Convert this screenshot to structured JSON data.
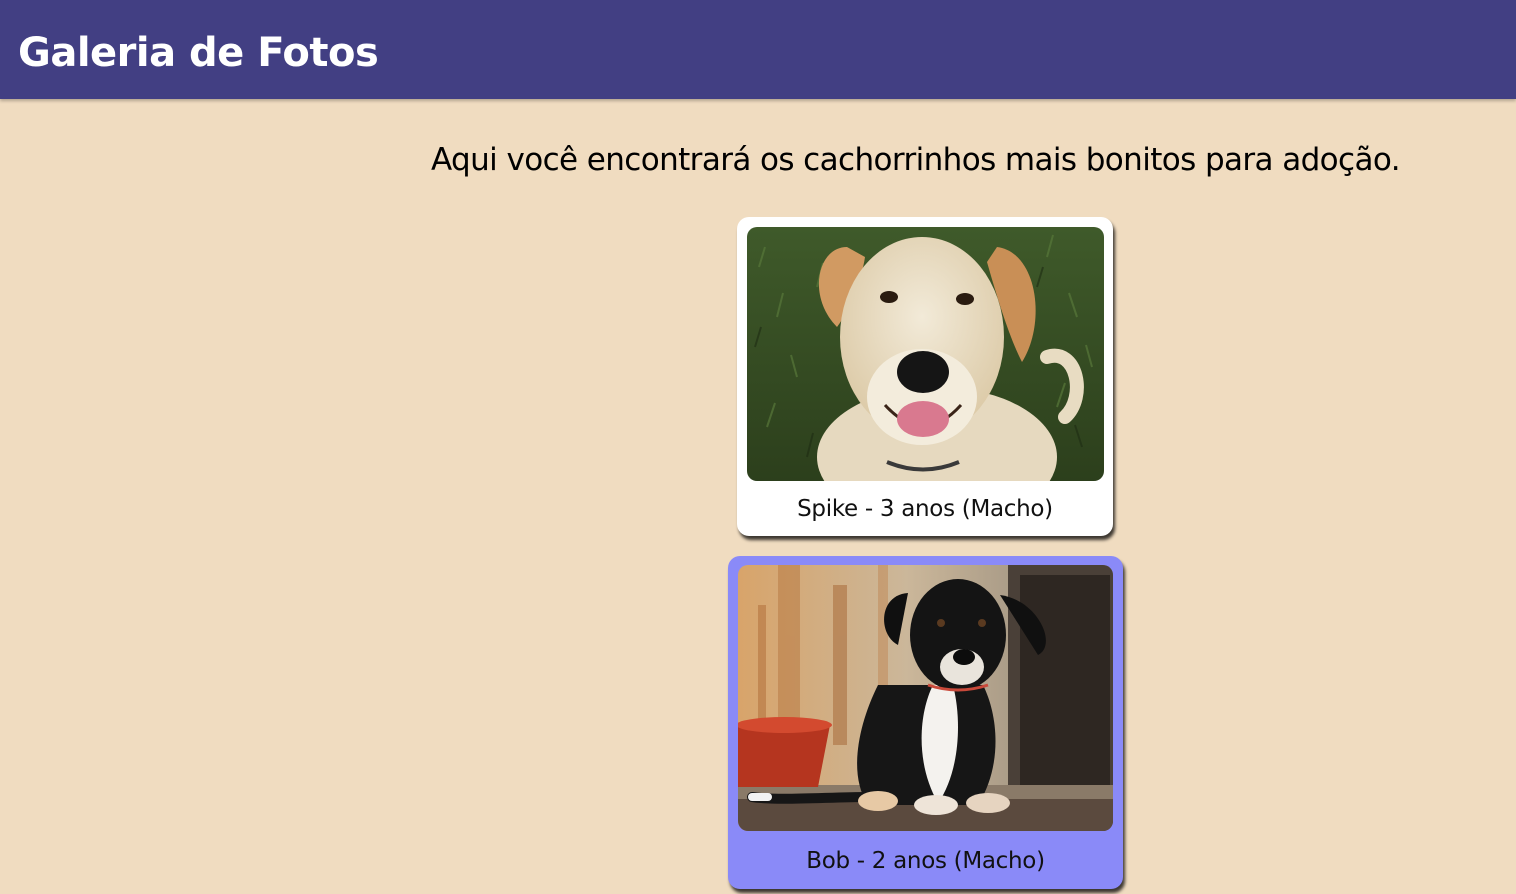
{
  "header": {
    "title": "Galeria de Fotos"
  },
  "main": {
    "intro": "Aqui você encontrará os cachorrinhos mais bonitos para adoção."
  },
  "gallery": {
    "cards": [
      {
        "caption": "Spike - 3 anos (Macho)",
        "photo": "dog-photo-spike",
        "background": "#ffffff"
      },
      {
        "caption": "Bob - 2 anos (Macho)",
        "photo": "dog-photo-bob",
        "background": "#8a8af8",
        "state": "hover"
      }
    ]
  },
  "colors": {
    "header_bg": "#423f83",
    "page_bg": "#f0dcc0",
    "hover_card_bg": "#8a8af8"
  }
}
